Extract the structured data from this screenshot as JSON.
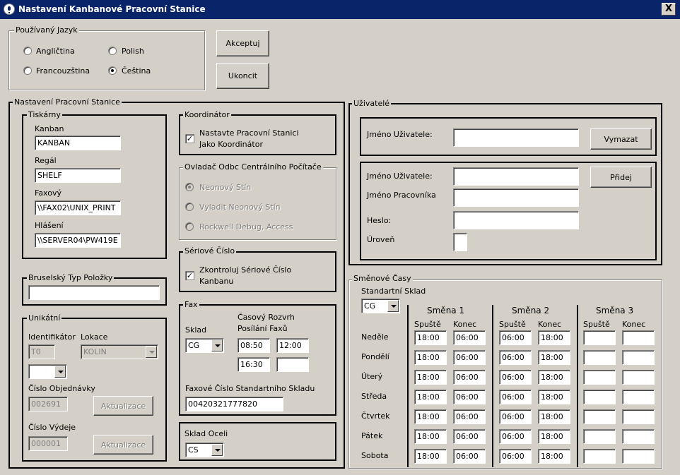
{
  "window": {
    "title": "Nastavení Kanbanové Pracovní Stanice",
    "close": "X"
  },
  "language": {
    "legend": "Používaný Jazyk",
    "options": [
      "Angličtina",
      "Polish",
      "Francouzština",
      "Čeština"
    ],
    "selected": "Čeština"
  },
  "buttons": {
    "accept": "Akceptuj",
    "exit": "Ukoncit"
  },
  "station": {
    "legend": "Nastavení Pracovní Stanice"
  },
  "printers": {
    "legend": "Tiskárny",
    "kanban_label": "Kanban",
    "kanban_value": "KANBAN",
    "shelf_label": "Regál",
    "shelf_value": "SHELF",
    "fax_label": "Faxový",
    "fax_value": "\\\\FAX02\\UNIX_PRINT",
    "report_label": "Hlášení",
    "report_value": "\\\\SERVER04\\PW419E"
  },
  "coordinator": {
    "legend": "Koordinátor",
    "checkbox_label_1": "Nastavte Pracovní Stanici",
    "checkbox_label_2": "Jako Koordinátor",
    "checked": true
  },
  "driver": {
    "legend": "Ovladač Odbc Centrálního Počítače",
    "options": [
      "Neonový Stín",
      "Vyladit Neonový Stín",
      "Rockwell Debug, Access"
    ],
    "selected": "Neonový Stín"
  },
  "serial": {
    "legend": "Sériové Číslo",
    "checkbox_label_1": "Zkontroluj Sériové Číslo",
    "checkbox_label_2": "Kanbanu",
    "checked": true
  },
  "brussels": {
    "legend": "Bruselský Typ Položky",
    "value": ""
  },
  "unique": {
    "legend": "Unikátní",
    "identifier_label": "Identifikátor",
    "identifier_value": "T0",
    "location_label": "Lokace",
    "location_value": "KOLIN",
    "order_label": "Číslo Objednávky",
    "order_value": "002691",
    "issue_label": "Číslo Výdeje",
    "issue_value": "000001",
    "update_label": "Aktualizace"
  },
  "fax": {
    "legend": "Fax",
    "store_label": "Sklad",
    "store_value": "CG",
    "schedule_label_1": "Časový Rozvrh",
    "schedule_label_2": "Posílání Faxů",
    "times": [
      "08:50",
      "12:00",
      "16:30",
      ""
    ],
    "number_label": "Faxové Číslo Standartního Skladu",
    "number_value": "00420321777820"
  },
  "steel": {
    "legend": "Sklad Oceli",
    "value": "CS"
  },
  "users": {
    "legend": "Uživatelé",
    "username_label": "Jméno Uživatele:",
    "username_value": "",
    "delete": "Vymazat",
    "new_username_label": "Jméno Uživatele:",
    "worker_name_label": "Jméno Pracovníka",
    "password_label": "Heslo:",
    "level_label": "Úroveň",
    "add": "Přidej"
  },
  "shifts": {
    "legend": "Směnové Časy",
    "default_store_label": "Standartní Sklad",
    "default_store_value": "CG",
    "shift_names": [
      "Směna 1",
      "Směna 2",
      "Směna 3"
    ],
    "start_label": "Spuště",
    "end_label": "Konec",
    "days": [
      {
        "name": "Neděle",
        "s1": [
          "18:00",
          "06:00"
        ],
        "s2": [
          "06:00",
          "18:00"
        ],
        "s3": [
          "",
          ""
        ]
      },
      {
        "name": "Pondělí",
        "s1": [
          "18:00",
          "06:00"
        ],
        "s2": [
          "06:00",
          "18:00"
        ],
        "s3": [
          "",
          ""
        ]
      },
      {
        "name": "Úterý",
        "s1": [
          "18:00",
          "06:00"
        ],
        "s2": [
          "06:00",
          "18:00"
        ],
        "s3": [
          "",
          ""
        ]
      },
      {
        "name": "Středa",
        "s1": [
          "18:00",
          "06:00"
        ],
        "s2": [
          "06:00",
          "18:00"
        ],
        "s3": [
          "",
          ""
        ]
      },
      {
        "name": "Čtvrtek",
        "s1": [
          "18:00",
          "06:00"
        ],
        "s2": [
          "06:00",
          "18:00"
        ],
        "s3": [
          "",
          ""
        ]
      },
      {
        "name": "Pátek",
        "s1": [
          "18:00",
          "06:00"
        ],
        "s2": [
          "06:00",
          "18:00"
        ],
        "s3": [
          "",
          ""
        ]
      },
      {
        "name": "Sobota",
        "s1": [
          "18:00",
          "06:00"
        ],
        "s2": [
          "06:00",
          "18:00"
        ],
        "s3": [
          "",
          ""
        ]
      }
    ]
  }
}
